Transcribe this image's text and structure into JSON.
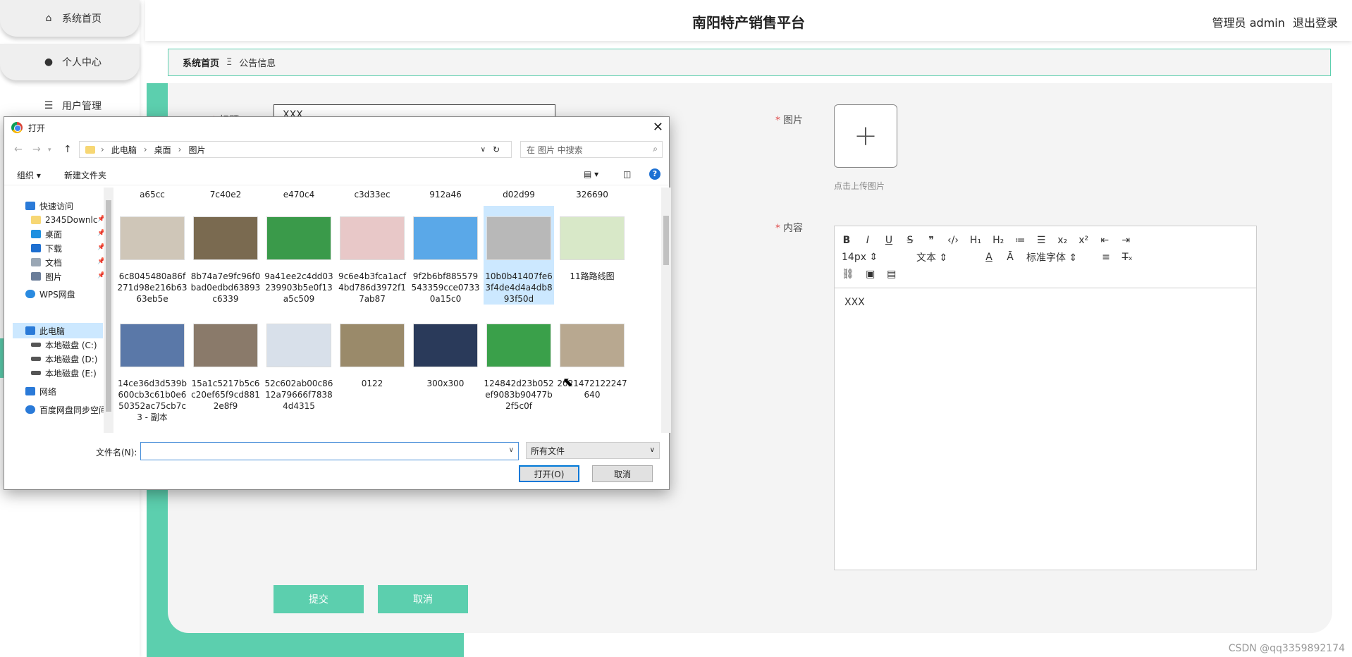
{
  "sidebar": {
    "items": [
      {
        "label": "系统首页",
        "icon": "home-icon"
      },
      {
        "label": "个人中心",
        "icon": "person-icon"
      },
      {
        "label": "用户管理",
        "icon": "sliders-icon"
      }
    ]
  },
  "header": {
    "title": "南阳特产销售平台",
    "user_label": "管理员 admin",
    "logout": "退出登录"
  },
  "breadcrumb": {
    "home": "系统首页",
    "sep": "Ξ",
    "current": "公告信息"
  },
  "form": {
    "title_label": "标题",
    "title_value": "XXX",
    "image_label": "图片",
    "upload_tip": "点击上传图片",
    "content_label": "内容",
    "content_value": "XXX",
    "font_size": "14px",
    "text_style": "文本",
    "font_family": "标准字体",
    "submit": "提交",
    "cancel": "取消"
  },
  "dialog": {
    "title": "打开",
    "path": [
      "此电脑",
      "桌面",
      "图片"
    ],
    "search_placeholder": "在 图片 中搜索",
    "organize": "组织 ▾",
    "new_folder": "新建文件夹",
    "tree": [
      {
        "label": "快速访问",
        "color": "#2a7ad8"
      },
      {
        "label": "2345Downlc",
        "color": "#f7d774"
      },
      {
        "label": "桌面",
        "color": "#1e90e0"
      },
      {
        "label": "下载",
        "color": "#1e6fd0"
      },
      {
        "label": "文档",
        "color": "#9aa7b5"
      },
      {
        "label": "图片",
        "color": "#6a7d99"
      },
      {
        "label": "WPS网盘",
        "color": "#2a8ae0"
      },
      {
        "label": "此电脑",
        "color": "#2a7ad8"
      },
      {
        "label": "本地磁盘 (C:)",
        "color": "#555"
      },
      {
        "label": "本地磁盘 (D:)",
        "color": "#555"
      },
      {
        "label": "本地磁盘 (E:)",
        "color": "#555"
      },
      {
        "label": "网络",
        "color": "#2a7ad8"
      },
      {
        "label": "百度网盘同步空间",
        "color": "#2a7ad8"
      }
    ],
    "top_row": [
      "a65cc",
      "7c40e2",
      "e470c4",
      "c3d33ec",
      "912a46",
      "d02d99",
      "326690"
    ],
    "row1": [
      {
        "name": "6c8045480a86f271d98e216b6363eb5e",
        "color": "#cfc6b8"
      },
      {
        "name": "8b74a7e9fc96f0bad0edbd63893c6339",
        "color": "#7a6a50"
      },
      {
        "name": "9a41ee2c4dd03239903b5e0f13a5c509",
        "color": "#3a9a4a"
      },
      {
        "name": "9c6e4b3fca1acf4bd786d3972f17ab87",
        "color": "#e8c8c8"
      },
      {
        "name": "9f2b6bf885579543359cce07330a15c0",
        "color": "#5aa8e8"
      },
      {
        "name": "10b0b41407fe63f4de4d4a4db893f50d",
        "color": "#b8b8b8"
      },
      {
        "name": "11路路线图",
        "color": "#d8e8c8"
      }
    ],
    "row2": [
      {
        "name": "14ce36d3d539b600cb3c61b0e650352ac75cb7c3 - 副本",
        "color": "#5a78a8"
      },
      {
        "name": "15a1c5217b5c6c20ef65f9cd8812e8f9",
        "color": "#8a7a6a"
      },
      {
        "name": "52c602ab00c8612a79666f78384d4315",
        "color": "#d8e0ea"
      },
      {
        "name": "0122",
        "color": "#9a8a6a"
      },
      {
        "name": "300x300",
        "color": "#2a3a5a"
      },
      {
        "name": "124842d23b052ef9083b90477b2f5c0f",
        "color": "#3aa04a"
      },
      {
        "name": "2021472122247640",
        "color": "#b8a890"
      }
    ],
    "filename_label": "文件名(N):",
    "filename_value": "",
    "filetype": "所有文件",
    "open": "打开(O)",
    "cancel": "取消"
  },
  "watermark": "CSDN @qq3359892174"
}
